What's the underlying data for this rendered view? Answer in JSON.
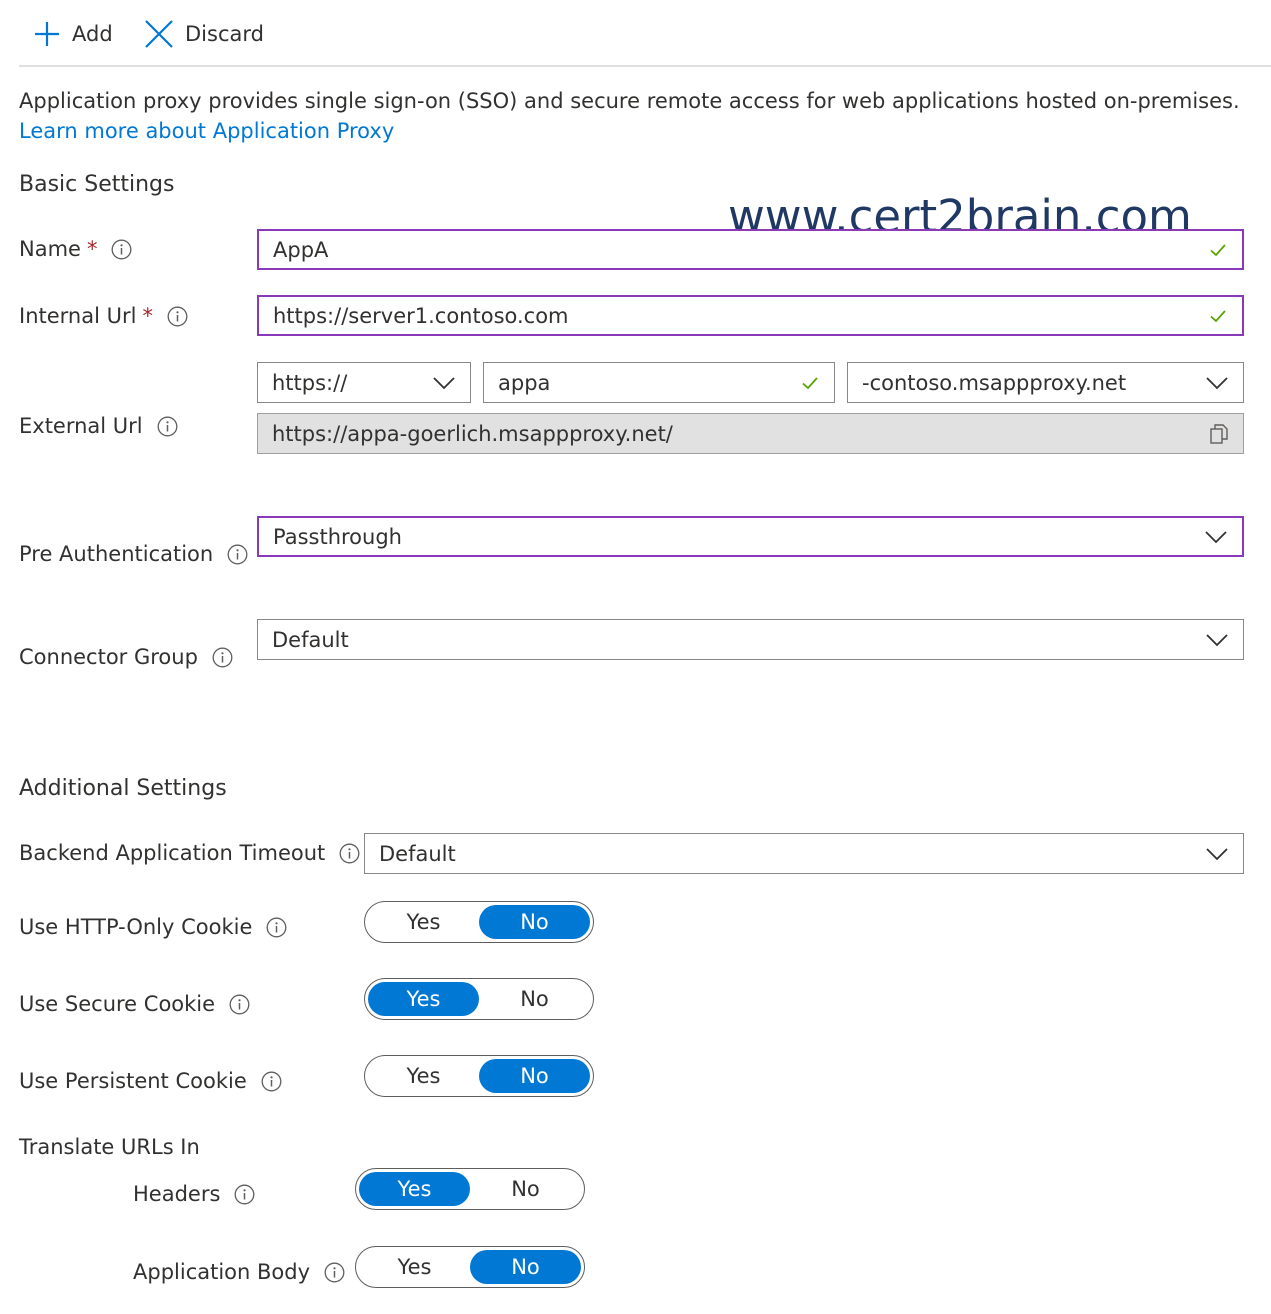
{
  "toolbar": {
    "add_label": "Add",
    "discard_label": "Discard"
  },
  "description": {
    "text": "Application proxy provides single sign-on (SSO) and secure remote access for web applications hosted on-premises.",
    "link": "Learn more about Application Proxy"
  },
  "basic_settings": {
    "heading": "Basic Settings",
    "name": {
      "label": "Name",
      "required_mark": "*",
      "value": "AppA"
    },
    "internal_url": {
      "label": "Internal Url",
      "required_mark": "*",
      "value": "https://server1.contoso.com"
    },
    "external_url": {
      "label": "External Url",
      "scheme": "https://",
      "subdomain": "appa",
      "domain": "-contoso.msappproxy.net",
      "full": "https://appa-goerlich.msappproxy.net/"
    },
    "pre_authentication": {
      "label": "Pre Authentication",
      "value": "Passthrough"
    },
    "connector_group": {
      "label": "Connector Group",
      "value": "Default"
    }
  },
  "watermark": "www.cert2brain.com",
  "additional_settings": {
    "heading": "Additional Settings",
    "backend_timeout": {
      "label": "Backend Application Timeout",
      "value": "Default"
    },
    "http_only_cookie": {
      "label": "Use HTTP-Only Cookie",
      "yes": "Yes",
      "no": "No",
      "selected": "No"
    },
    "secure_cookie": {
      "label": "Use Secure Cookie",
      "yes": "Yes",
      "no": "No",
      "selected": "Yes"
    },
    "persistent_cookie": {
      "label": "Use Persistent Cookie",
      "yes": "Yes",
      "no": "No",
      "selected": "No"
    },
    "translate_urls": {
      "label": "Translate URLs In",
      "headers": {
        "label": "Headers",
        "yes": "Yes",
        "no": "No",
        "selected": "Yes"
      },
      "application_body": {
        "label": "Application Body",
        "yes": "Yes",
        "no": "No",
        "selected": "No"
      }
    }
  },
  "colors": {
    "accent": "#0078d4",
    "focus_border": "#8a3ab9",
    "valid_check": "#57a300",
    "required": "#a4262c"
  },
  "icons": {
    "add": "plus-icon",
    "discard": "close-icon",
    "info": "info-icon",
    "valid": "checkmark-icon",
    "dropdown": "chevron-down-icon",
    "copy": "copy-icon"
  }
}
